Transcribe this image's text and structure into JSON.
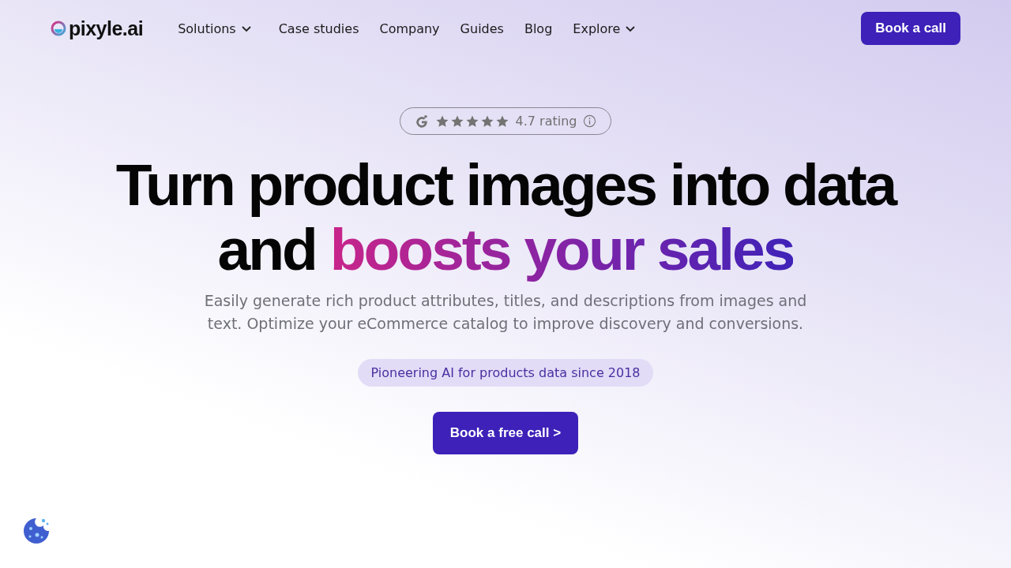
{
  "logo": {
    "text": "pixyle.ai"
  },
  "nav": [
    {
      "label": "Solutions",
      "kind": "dropdown"
    },
    {
      "label": "Case studies",
      "kind": "link"
    },
    {
      "label": "Company",
      "kind": "link"
    },
    {
      "label": "Guides",
      "kind": "link"
    },
    {
      "label": "Blog",
      "kind": "link"
    },
    {
      "label": "Explore",
      "kind": "dropdown"
    }
  ],
  "header_button": "Book a call",
  "rating": {
    "stars": 5,
    "text": "4.7 rating"
  },
  "headline": {
    "line_1": "Turn product images into data",
    "line_2_start": "and",
    "line_2_highlight": "boosts your sales"
  },
  "subtitle": "Easily generate rich product attributes, titles, and descriptions from images and text. Optimize your eCommerce catalog to improve discovery and conversions.",
  "badge": "Pioneering AI for products data since 2018",
  "cta_button": "Book a free call >"
}
